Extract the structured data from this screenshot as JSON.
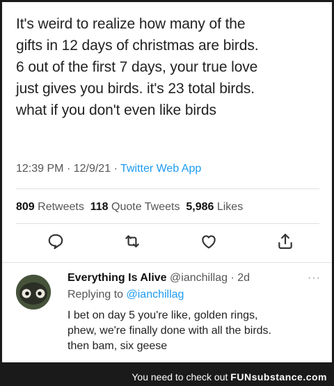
{
  "tweet": {
    "lines": [
      "It's weird to realize how many of the",
      "gifts in 12 days of christmas are birds.",
      "6 out of the first 7 days, your true love",
      "just gives you birds. it's 23 total birds.",
      "what if you don't even like birds"
    ],
    "time": "12:39 PM",
    "date": "12/9/21",
    "source": "Twitter Web App",
    "retweets_count": "809",
    "retweets_label": "Retweets",
    "quotes_count": "118",
    "quotes_label": "Quote Tweets",
    "likes_count": "5,986",
    "likes_label": "Likes"
  },
  "actions": {
    "icons": [
      "reply-icon",
      "retweet-icon",
      "like-icon",
      "share-icon"
    ]
  },
  "reply": {
    "name": "Everything Is Alive",
    "handle": "@ianchillag",
    "age": "2d",
    "replying_to_label": "Replying to",
    "replying_to_handle": "@ianchillag",
    "lines": [
      "I bet on day 5 you're like, golden rings,",
      "phew, we're finally done with all the birds.",
      "then bam, six geese"
    ]
  },
  "footer": {
    "text": "You need to check out",
    "brand": "FUNsubstance.com"
  },
  "colors": {
    "accent": "#1d9bf0",
    "text": "#222222",
    "muted": "#555555",
    "background": "#1a1a1a"
  }
}
